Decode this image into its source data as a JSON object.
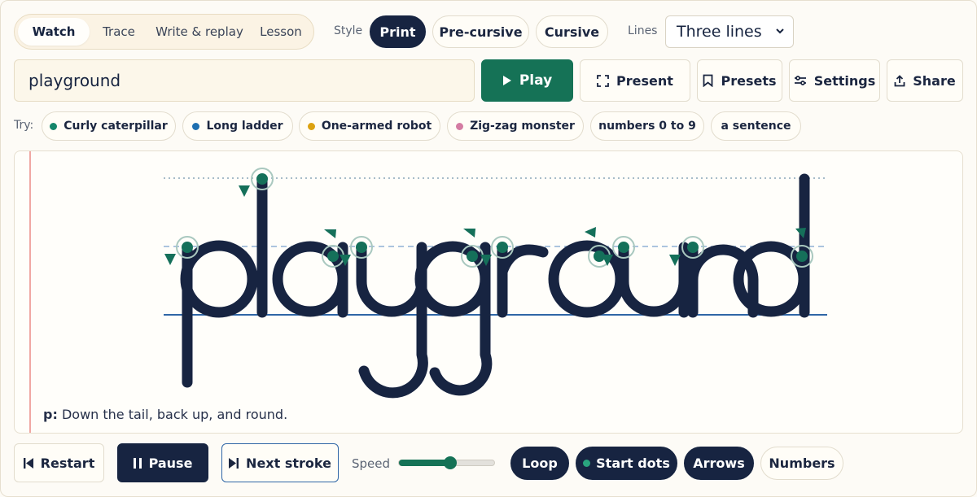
{
  "modes": {
    "tabs": [
      "Watch",
      "Trace",
      "Write & replay",
      "Lesson"
    ],
    "active": "Watch"
  },
  "style": {
    "label": "Style",
    "options": [
      "Print",
      "Pre-cursive",
      "Cursive"
    ],
    "active": "Print"
  },
  "lines": {
    "label": "Lines",
    "value": "Three lines"
  },
  "input": {
    "value": "playground"
  },
  "actions": {
    "play": "Play",
    "present": "Present",
    "presets": "Presets",
    "settings": "Settings",
    "share": "Share"
  },
  "try": {
    "label": "Try:",
    "items": [
      {
        "label": "Curly caterpillar",
        "dot_color": "#14866a"
      },
      {
        "label": "Long ladder",
        "dot_color": "#1e6fb0"
      },
      {
        "label": "One-armed robot",
        "dot_color": "#dca211"
      },
      {
        "label": "Zig-zag monster",
        "dot_color": "#d47ca3"
      },
      {
        "label": "numbers 0 to 9",
        "dot_color": ""
      },
      {
        "label": "a sentence",
        "dot_color": ""
      }
    ]
  },
  "canvas": {
    "word": "playground",
    "hint_letter": "p:",
    "hint_text": "Down the tail, back up, and round."
  },
  "controls": {
    "restart": "Restart",
    "pause": "Pause",
    "next_stroke": "Next stroke",
    "speed_label": "Speed",
    "speed_value": 0.5,
    "toggles": [
      {
        "label": "Loop",
        "on": true
      },
      {
        "label": "Start dots",
        "on": true
      },
      {
        "label": "Arrows",
        "on": true
      },
      {
        "label": "Numbers",
        "on": false
      }
    ]
  },
  "colors": {
    "ink": "#172441",
    "accent": "#157256",
    "baseline": "#2f66a6",
    "margin": "#f0a8a3"
  }
}
